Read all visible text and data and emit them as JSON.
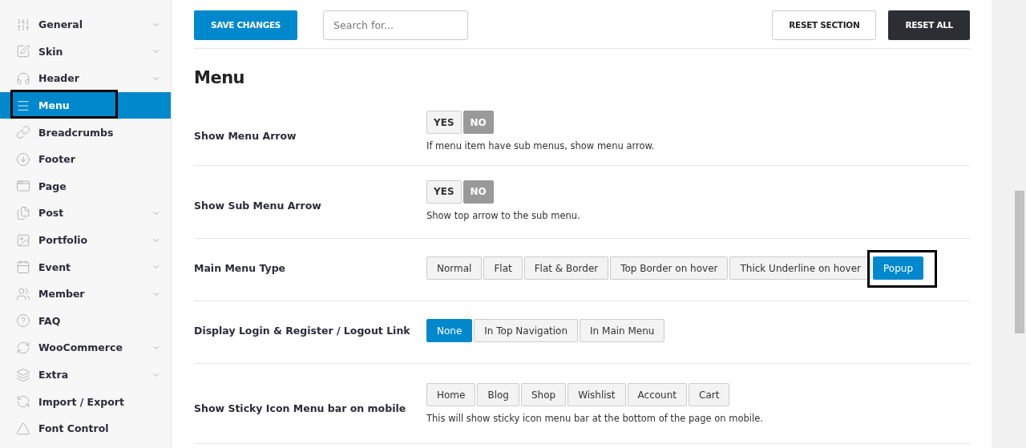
{
  "sidebar": {
    "items": [
      {
        "label": "General",
        "selected": false,
        "expandable": true
      },
      {
        "label": "Skin",
        "selected": false,
        "expandable": true
      },
      {
        "label": "Header",
        "selected": false,
        "expandable": true
      },
      {
        "label": "Menu",
        "selected": true,
        "expandable": false,
        "highlighted": true
      },
      {
        "label": "Breadcrumbs",
        "selected": false,
        "expandable": false
      },
      {
        "label": "Footer",
        "selected": false,
        "expandable": false
      },
      {
        "label": "Page",
        "selected": false,
        "expandable": false
      },
      {
        "label": "Post",
        "selected": false,
        "expandable": true
      },
      {
        "label": "Portfolio",
        "selected": false,
        "expandable": true
      },
      {
        "label": "Event",
        "selected": false,
        "expandable": true
      },
      {
        "label": "Member",
        "selected": false,
        "expandable": true
      },
      {
        "label": "FAQ",
        "selected": false,
        "expandable": false
      },
      {
        "label": "WooCommerce",
        "selected": false,
        "expandable": true
      },
      {
        "label": "Extra",
        "selected": false,
        "expandable": true
      },
      {
        "label": "Import / Export",
        "selected": false,
        "expandable": false
      },
      {
        "label": "Font Control",
        "selected": false,
        "expandable": false
      }
    ]
  },
  "toolbar": {
    "save_button": "SAVE CHANGES",
    "search": {
      "placeholder": "Search for..."
    },
    "reset_section_button": "RESET SECTION",
    "reset_all_button": "RESET ALL"
  },
  "section": {
    "title": "Menu",
    "settings": [
      {
        "label": "Show Menu Arrow",
        "kind": "toggle",
        "options": [
          {
            "label": "YES",
            "selected": false
          },
          {
            "label": "NO",
            "selected": true
          }
        ],
        "description": "If menu item have sub menus, show menu arrow."
      },
      {
        "label": "Show Sub Menu Arrow",
        "kind": "toggle",
        "options": [
          {
            "label": "YES",
            "selected": false
          },
          {
            "label": "NO",
            "selected": true
          }
        ],
        "description": "Show top arrow to the sub menu."
      },
      {
        "label": "Main Menu Type",
        "kind": "buttonset",
        "options": [
          {
            "label": "Normal",
            "selected": false
          },
          {
            "label": "Flat",
            "selected": false
          },
          {
            "label": "Flat & Border",
            "selected": false
          },
          {
            "label": "Top Border on hover",
            "selected": false
          },
          {
            "label": "Thick Underline on hover",
            "selected": false
          },
          {
            "label": "Popup",
            "selected": true,
            "highlighted": true
          }
        ]
      },
      {
        "label": "Display Login & Register / Logout Link",
        "kind": "buttonset",
        "options": [
          {
            "label": "None",
            "selected": true
          },
          {
            "label": "In Top Navigation",
            "selected": false
          },
          {
            "label": "In Main Menu",
            "selected": false
          }
        ]
      },
      {
        "label": "Show Sticky Icon Menu bar on mobile",
        "kind": "buttonset",
        "options": [
          {
            "label": "Home",
            "selected": false
          },
          {
            "label": "Blog",
            "selected": false
          },
          {
            "label": "Shop",
            "selected": false
          },
          {
            "label": "Wishlist",
            "selected": false
          },
          {
            "label": "Account",
            "selected": false
          },
          {
            "label": "Cart",
            "selected": false
          }
        ],
        "description": "This will show sticky icon menu bar at the bottom of the page on mobile."
      }
    ]
  }
}
